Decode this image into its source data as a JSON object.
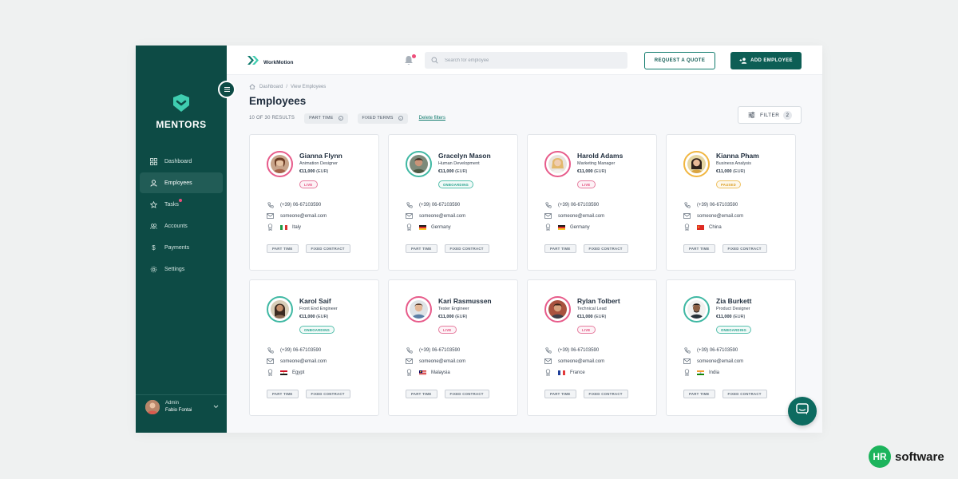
{
  "colors": {
    "sidebar_bg": "#0d4b45",
    "accent": "#0d5e55",
    "status_live": "#e2497a",
    "status_onboarding": "#22a08b",
    "status_paused": "#d99a1c"
  },
  "sidebar": {
    "brand": "MENTORS",
    "items": [
      {
        "label": "Dashboard",
        "icon": "dashboard-icon",
        "active": false
      },
      {
        "label": "Employees",
        "icon": "user-icon",
        "active": true
      },
      {
        "label": "Tasks",
        "icon": "star-icon",
        "active": false,
        "badge": true
      },
      {
        "label": "Accounts",
        "icon": "users-icon",
        "active": false
      },
      {
        "label": "Payments",
        "icon": "dollar-icon",
        "active": false
      },
      {
        "label": "Settings",
        "icon": "gear-icon",
        "active": false
      }
    ],
    "user": {
      "role": "Admin",
      "name": "Fabio Fontai"
    }
  },
  "topbar": {
    "logo_text": "WorkMotion",
    "search_placeholder": "Search for employee",
    "request_quote_label": "REQUEST A QUOTE",
    "add_employee_label": "ADD EMPLOYEE"
  },
  "header": {
    "breadcrumb": [
      "Dashboard",
      "View Employees"
    ],
    "title": "Employees",
    "results": "10 OF 30 RESULTS",
    "chips": [
      "PART TIME",
      "FIXED TERMS"
    ],
    "delete_filters": "Delete filters",
    "filter_label": "FILTER",
    "filter_count": "2"
  },
  "employees": [
    {
      "name": "Gianna Flynn",
      "role": "Animation Designer",
      "salary": "€11,000",
      "currency": "(EUR)",
      "status": "LIVE",
      "status_type": "live",
      "phone": "(+39) 06-67103590",
      "email": "someone@email.com",
      "country": "Italy",
      "flag": "italy",
      "tags": [
        "PART TIME",
        "FIXED CONTRACT"
      ]
    },
    {
      "name": "Gracelyn Mason",
      "role": "Human Development",
      "salary": "€11,000",
      "currency": "(EUR)",
      "status": "ONBOARDING",
      "status_type": "onb",
      "phone": "(+39) 06-67103590",
      "email": "someone@email.com",
      "country": "Germany",
      "flag": "germany",
      "tags": [
        "PART TIME",
        "FIXED CONTRACT"
      ]
    },
    {
      "name": "Harold Adams",
      "role": "Marketing Manager",
      "salary": "€11,000",
      "currency": "(EUR)",
      "status": "LIVE",
      "status_type": "live",
      "phone": "(+39) 06-67103590",
      "email": "someone@email.com",
      "country": "Germany",
      "flag": "germany",
      "tags": [
        "PART TIME",
        "FIXED CONTRACT"
      ]
    },
    {
      "name": "Kianna Pham",
      "role": "Business Analysis",
      "salary": "€11,000",
      "currency": "(EUR)",
      "status": "PAUSED",
      "status_type": "paused",
      "phone": "(+39) 06-67103590",
      "email": "someone@email.com",
      "country": "China",
      "flag": "china",
      "tags": [
        "PART TIME",
        "FIXED CONTRACT"
      ]
    },
    {
      "name": "Karol Saif",
      "role": "Front End Engineer",
      "salary": "€11,000",
      "currency": "(EUR)",
      "status": "ONBOARDING",
      "status_type": "onb",
      "phone": "(+39) 06-67103590",
      "email": "someone@email.com",
      "country": "Egypt",
      "flag": "egypt",
      "tags": [
        "PART TIME",
        "FIXED CONTRACT"
      ]
    },
    {
      "name": "Kari Rasmussen",
      "role": "Tester Engineer",
      "salary": "€11,000",
      "currency": "(EUR)",
      "status": "LIVE",
      "status_type": "live",
      "phone": "(+39) 06-67103590",
      "email": "someone@email.com",
      "country": "Malaysia",
      "flag": "malaysia",
      "tags": [
        "PART TIME",
        "FIXED CONTRACT"
      ]
    },
    {
      "name": "Rylan Tolbert",
      "role": "Technical Lead",
      "salary": "€11,000",
      "currency": "(EUR)",
      "status": "LIVE",
      "status_type": "live",
      "phone": "(+39) 06-67103590",
      "email": "someone@email.com",
      "country": "France",
      "flag": "france",
      "tags": [
        "PART TIME",
        "FIXED CONTRACT"
      ]
    },
    {
      "name": "Zia Burkett",
      "role": "Product Designer",
      "salary": "€11,000",
      "currency": "(EUR)",
      "status": "ONBOARDING",
      "status_type": "onb",
      "phone": "(+39) 06-67103590",
      "email": "someone@email.com",
      "country": "India",
      "flag": "india",
      "tags": [
        "PART TIME",
        "FIXED CONTRACT"
      ]
    }
  ],
  "watermark": {
    "mark": "HR",
    "text": "software"
  }
}
